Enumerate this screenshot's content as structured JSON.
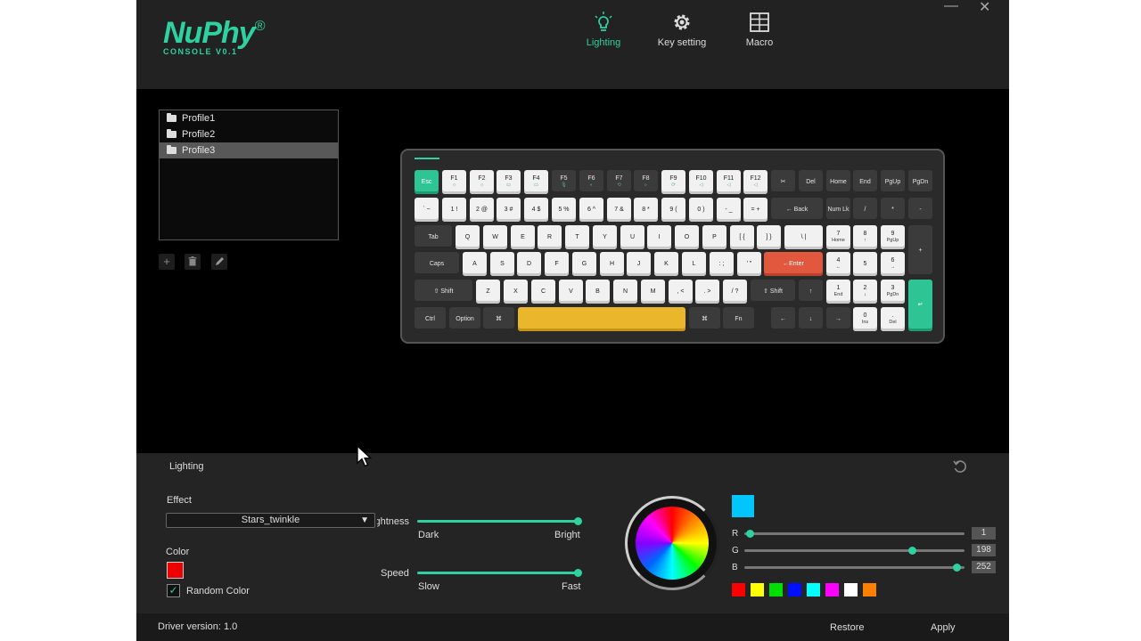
{
  "app": {
    "brand": "NuPhy",
    "brand_mark": "®",
    "subtitle": "CONSOLE V0.1"
  },
  "nav": {
    "items": [
      {
        "label": "Lighting",
        "icon": "bulb-icon",
        "active": true
      },
      {
        "label": "Key setting",
        "icon": "gear-icon",
        "active": false
      },
      {
        "label": "Macro",
        "icon": "grid-icon",
        "active": false
      }
    ]
  },
  "window": {
    "minimize": "—",
    "close": "✕"
  },
  "profiles": {
    "items": [
      {
        "label": "Profile1",
        "selected": false
      },
      {
        "label": "Profile2",
        "selected": false
      },
      {
        "label": "Profile3",
        "selected": true
      }
    ],
    "buttons": {
      "add": "+",
      "delete": "🗑",
      "edit": "✎"
    }
  },
  "keyboard": {
    "rows": [
      [
        [
          "Esc",
          ""
        ],
        [
          "F1",
          "☼"
        ],
        [
          "F2",
          "☼"
        ],
        [
          "F3",
          "▭"
        ],
        [
          "F4",
          "▭"
        ],
        [
          "F5",
          "🎙"
        ],
        [
          "F6",
          "◐"
        ],
        [
          "F7",
          "⟲"
        ],
        [
          "F8",
          "▹"
        ],
        [
          "F9",
          "⟳"
        ],
        [
          "F10",
          "◁"
        ],
        [
          "F11",
          "◁"
        ],
        [
          "F12",
          "◁"
        ],
        [
          "✂",
          ""
        ],
        [
          "Del",
          ""
        ],
        [
          "Home",
          ""
        ],
        [
          "End",
          ""
        ],
        [
          "PgUp",
          ""
        ],
        [
          "PgDn",
          ""
        ]
      ],
      [
        [
          "` ~",
          ""
        ],
        [
          "1 !",
          ""
        ],
        [
          "2 @",
          ""
        ],
        [
          "3 #",
          ""
        ],
        [
          "4 $",
          ""
        ],
        [
          "5 %",
          ""
        ],
        [
          "6 ^",
          ""
        ],
        [
          "7 &",
          ""
        ],
        [
          "8 *",
          ""
        ],
        [
          "9 (",
          ""
        ],
        [
          "0 )",
          ""
        ],
        [
          "- _",
          ""
        ],
        [
          "= +",
          ""
        ],
        [
          "← Back",
          ""
        ],
        [
          "Num Lk",
          ""
        ],
        [
          "/",
          ""
        ],
        [
          "*",
          ""
        ],
        [
          "-",
          ""
        ]
      ],
      [
        [
          "Tab",
          ""
        ],
        [
          "Q",
          ""
        ],
        [
          "W",
          ""
        ],
        [
          "E",
          ""
        ],
        [
          "R",
          ""
        ],
        [
          "T",
          ""
        ],
        [
          "Y",
          ""
        ],
        [
          "U",
          ""
        ],
        [
          "I",
          ""
        ],
        [
          "O",
          ""
        ],
        [
          "P",
          ""
        ],
        [
          "[ {",
          ""
        ],
        [
          "] }",
          ""
        ],
        [
          "\\ |",
          ""
        ],
        [
          "7",
          "Home"
        ],
        [
          "8",
          "↑"
        ],
        [
          "9",
          "PgUp"
        ],
        [
          "+",
          ""
        ]
      ],
      [
        [
          "Caps",
          ""
        ],
        [
          "A",
          ""
        ],
        [
          "S",
          ""
        ],
        [
          "D",
          ""
        ],
        [
          "F",
          ""
        ],
        [
          "G",
          ""
        ],
        [
          "H",
          ""
        ],
        [
          "J",
          ""
        ],
        [
          "K",
          ""
        ],
        [
          "L",
          ""
        ],
        [
          ": ;",
          ""
        ],
        [
          "' \"",
          ""
        ],
        [
          "←Enter",
          ""
        ],
        [
          "4",
          "←"
        ],
        [
          "5",
          ""
        ],
        [
          "6",
          "→"
        ]
      ],
      [
        [
          "⇧ Shift",
          ""
        ],
        [
          "Z",
          ""
        ],
        [
          "X",
          ""
        ],
        [
          "C",
          ""
        ],
        [
          "V",
          ""
        ],
        [
          "B",
          ""
        ],
        [
          "N",
          ""
        ],
        [
          "M",
          ""
        ],
        [
          ", <",
          ""
        ],
        [
          ". >",
          ""
        ],
        [
          "/ ?",
          ""
        ],
        [
          "⇧ Shift",
          ""
        ],
        [
          "↑",
          ""
        ],
        [
          "1",
          "End"
        ],
        [
          "2",
          "↓"
        ],
        [
          "3",
          "PgDn"
        ],
        [
          "↵",
          ""
        ]
      ],
      [
        [
          "Ctrl",
          ""
        ],
        [
          "Option",
          ""
        ],
        [
          "⌘",
          ""
        ],
        [
          "",
          ""
        ],
        [
          "⌘",
          ""
        ],
        [
          "Fn",
          ""
        ],
        [
          "←",
          ""
        ],
        [
          "↓",
          ""
        ],
        [
          "→",
          ""
        ],
        [
          "0",
          "Ins"
        ],
        [
          ".",
          "Del"
        ]
      ]
    ]
  },
  "panel": {
    "title": "Lighting",
    "effect_label": "Effect",
    "effect_value": "Stars_twinkle",
    "color_label": "Color",
    "selected_color": "#e00000",
    "random_color_label": "Random Color",
    "random_color_checked": true,
    "brightness_label": "Brightness",
    "brightness_level": 1.0,
    "brightness_min": "Dark",
    "brightness_max": "Bright",
    "speed_label": "Speed",
    "speed_level": 1.0,
    "speed_min": "Slow",
    "speed_max": "Fast",
    "preview_color": "#01c6fc",
    "rgb": [
      {
        "label": "R",
        "value": "1"
      },
      {
        "label": "G",
        "value": "198"
      },
      {
        "label": "B",
        "value": "252"
      }
    ],
    "swatches": [
      "#ff0000",
      "#ffff00",
      "#00e000",
      "#0010ff",
      "#00ffff",
      "#ff00ff",
      "#ffffff",
      "#ff8000"
    ]
  },
  "footer": {
    "driver_version": "Driver version: 1.0",
    "restore": "Restore",
    "apply": "Apply"
  },
  "colors": {
    "accent": "#2ed1a0",
    "enter": "#e2583e",
    "space": "#eab62b"
  }
}
